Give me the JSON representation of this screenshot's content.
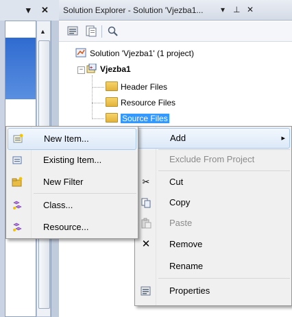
{
  "left_panel": {
    "dropdown_glyph": "▾",
    "close_glyph": "✕",
    "scroll_up_glyph": "▲"
  },
  "solution_explorer": {
    "title": "Solution Explorer - Solution 'Vjezba1...",
    "title_controls": [
      "▾",
      "⊥",
      "✕"
    ],
    "toolbar_icons": [
      "properties-icon",
      "show-all-files-icon",
      "refresh-icon"
    ],
    "tree": {
      "solution_label": "Solution 'Vjezba1' (1 project)",
      "project_label": "Vjezba1",
      "expander_glyph": "−",
      "folders": [
        "Header Files",
        "Resource Files",
        "Source Files"
      ]
    }
  },
  "context_menu": {
    "items": [
      {
        "label": "Add",
        "icon": "",
        "disabled": false,
        "highlighted": true,
        "submenu_arrow": "▸"
      },
      {
        "label": "Exclude From Project",
        "icon": "",
        "disabled": true
      },
      {
        "label": "Cut",
        "icon": "scissors-icon",
        "glyph": "✂",
        "disabled": false
      },
      {
        "label": "Copy",
        "icon": "copy-icon",
        "disabled": false
      },
      {
        "label": "Paste",
        "icon": "paste-icon",
        "disabled": true
      },
      {
        "label": "Remove",
        "icon": "remove-icon",
        "glyph": "✕",
        "disabled": false
      },
      {
        "label": "Rename",
        "icon": "",
        "disabled": false
      },
      {
        "label": "Properties",
        "icon": "properties-icon",
        "disabled": false
      }
    ]
  },
  "add_submenu": {
    "items": [
      {
        "label": "New Item...",
        "icon": "new-item-icon",
        "highlighted": true
      },
      {
        "label": "Existing Item...",
        "icon": "existing-item-icon"
      },
      {
        "label": "New Filter",
        "icon": "new-filter-icon"
      },
      {
        "label": "Class...",
        "icon": "class-icon"
      },
      {
        "label": "Resource...",
        "icon": "resource-icon"
      }
    ]
  },
  "colors": {
    "selection": "#3399ff",
    "menu_bg": "#f0f0f0",
    "menu_hot": "#dce9f8",
    "folder": "#e3b33a"
  }
}
